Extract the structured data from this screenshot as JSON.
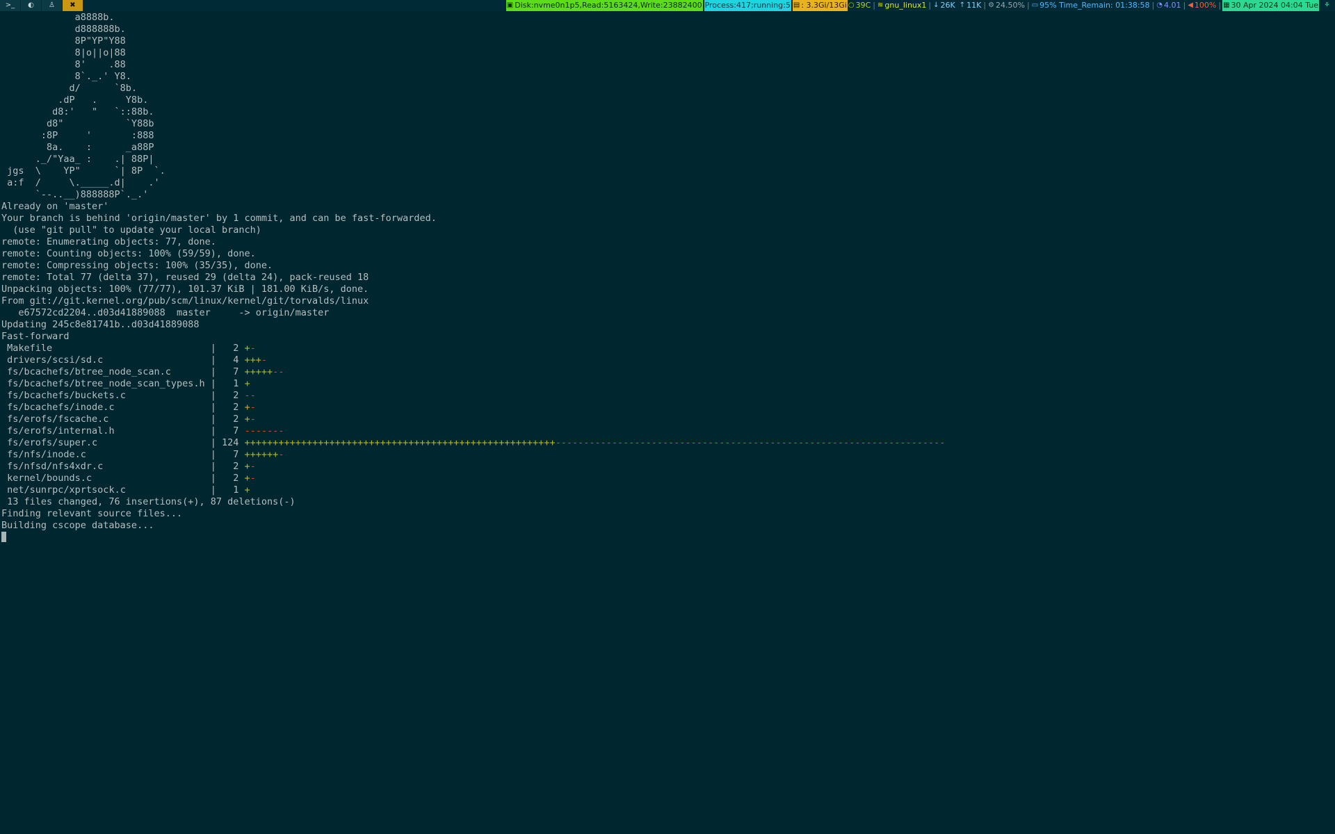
{
  "bar": {
    "tags": [
      {
        "name": "terminal-icon",
        "glyph": ">_"
      },
      {
        "name": "firefox-icon",
        "glyph": "◐"
      },
      {
        "name": "linux-icon",
        "glyph": "♙"
      },
      {
        "name": "tools-icon",
        "glyph": "✖"
      }
    ],
    "disk": "Disk:nvme0n1p5,Read:5163424,Write:23882400",
    "process": "Process:417;running:5",
    "memory": ": 3.3Gi/13Gi",
    "temp": "39C",
    "wifi": "gnu_linux1",
    "down": "26K",
    "up": "11K",
    "cpu": "24.50%",
    "battery": "95% Time_Remain: 01:38:58",
    "load": "4.01",
    "volume": "100%",
    "date": "30 Apr 2024 04:04 Tue",
    "colors": {
      "accent": "#c99712",
      "disk": "#5ddc1c",
      "process": "#1fd3e0",
      "memory": "#e8b31c",
      "date": "#2bd992",
      "volume": "#ff5b3a",
      "battery": "#4fb8ff"
    }
  },
  "terminal": {
    "art": [
      "             a8888b.",
      "             d888888b.",
      "             8P\"YP\"Y88",
      "             8|o||o|88",
      "             8'    .88",
      "             8`._.' Y8.",
      "            d/      `8b.",
      "          .dP   .     Y8b.",
      "         d8:'   \"   `::88b.",
      "        d8\"           `Y88b",
      "       :8P     '       :888",
      "        8a.    :      _a88P",
      "      ._/\"Yaa_ :    .| 88P|",
      " jgs  \\    YP\"      `| 8P  `.",
      " a:f  /     \\._____.d|    .'",
      "      `--..__)888888P`._.'"
    ],
    "git": [
      "Already on 'master'",
      "Your branch is behind 'origin/master' by 1 commit, and can be fast-forwarded.",
      "  (use \"git pull\" to update your local branch)",
      "remote: Enumerating objects: 77, done.",
      "remote: Counting objects: 100% (59/59), done.",
      "remote: Compressing objects: 100% (35/35), done.",
      "remote: Total 77 (delta 37), reused 29 (delta 24), pack-reused 18",
      "Unpacking objects: 100% (77/77), 101.37 KiB | 181.00 KiB/s, done.",
      "From git://git.kernel.org/pub/scm/linux/kernel/git/torvalds/linux",
      "   e67572cd2204..d03d41889088  master     -> origin/master",
      "Updating 245c8e81741b..d03d41889088",
      "Fast-forward"
    ],
    "diffstat": [
      {
        "file": "Makefile",
        "count": "2",
        "plus": "+",
        "minus": "-"
      },
      {
        "file": "drivers/scsi/sd.c",
        "count": "4",
        "plus": "+++",
        "minus": "-"
      },
      {
        "file": "fs/bcachefs/btree_node_scan.c",
        "count": "7",
        "plus": "+++++",
        "minus": "--"
      },
      {
        "file": "fs/bcachefs/btree_node_scan_types.h",
        "count": "1",
        "plus": "+",
        "minus": ""
      },
      {
        "file": "fs/bcachefs/buckets.c",
        "count": "2",
        "plus": "",
        "minus": "--"
      },
      {
        "file": "fs/bcachefs/inode.c",
        "count": "2",
        "plus": "+",
        "minus": "-"
      },
      {
        "file": "fs/erofs/fscache.c",
        "count": "2",
        "plus": "+",
        "minus": "-"
      },
      {
        "file": "fs/erofs/internal.h",
        "count": "7",
        "plus": "",
        "minus": "-------"
      },
      {
        "file": "fs/erofs/super.c",
        "count": "124",
        "plus": "+++++++++++++++++++++++++++++++++++++++++++++++++++++++",
        "minus": "---------------------------------------------------------------------"
      },
      {
        "file": "fs/nfs/inode.c",
        "count": "7",
        "plus": "++++++",
        "minus": "-"
      },
      {
        "file": "fs/nfsd/nfs4xdr.c",
        "count": "2",
        "plus": "+",
        "minus": "-"
      },
      {
        "file": "kernel/bounds.c",
        "count": "2",
        "plus": "+",
        "minus": "-"
      },
      {
        "file": "net/sunrpc/xprtsock.c",
        "count": "1",
        "plus": "+",
        "minus": ""
      }
    ],
    "summary": " 13 files changed, 76 insertions(+), 87 deletions(-)",
    "tail": [
      "Finding relevant source files...",
      "Building cscope database..."
    ]
  }
}
